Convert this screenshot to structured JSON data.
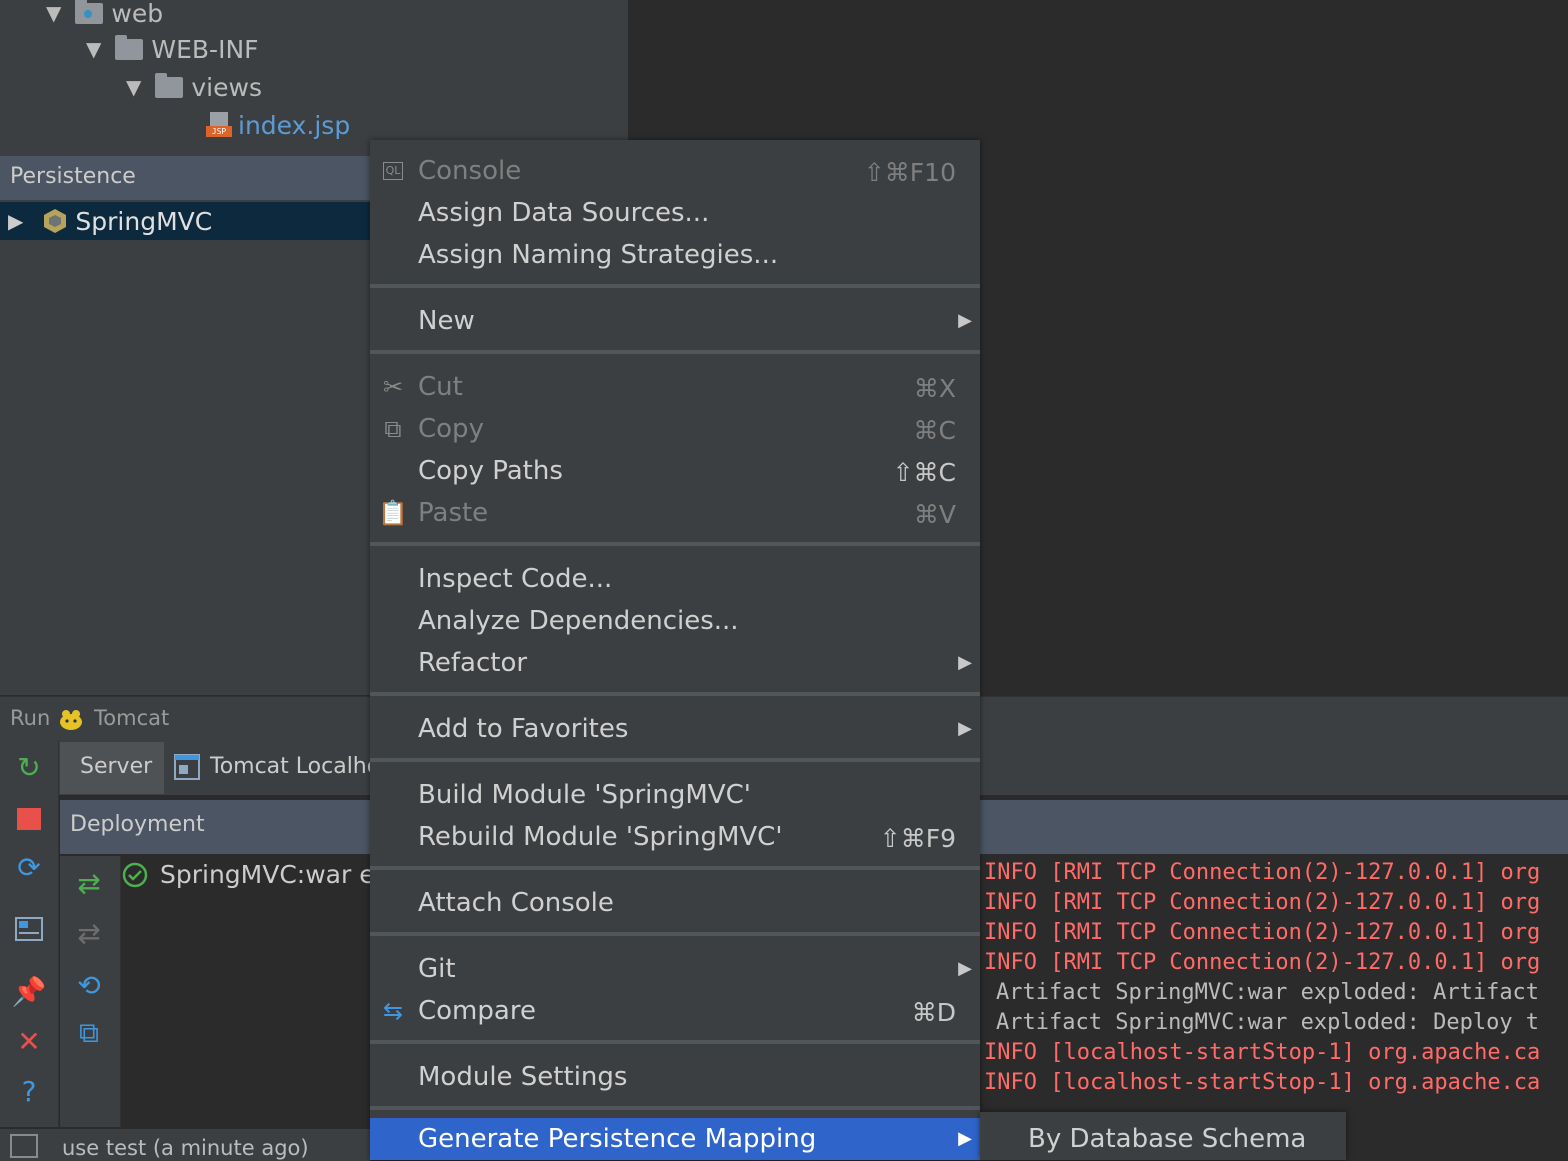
{
  "project_tree": {
    "items": [
      {
        "label": "web"
      },
      {
        "label": "WEB-INF"
      },
      {
        "label": "views"
      },
      {
        "label": "index.jsp"
      }
    ],
    "jsp_tag": "JSP",
    "selected_color": "#5c9bd6"
  },
  "persistence": {
    "title": "Persistence",
    "item": "SpringMVC"
  },
  "run_bar": {
    "run_label": "Run",
    "config_name": "Tomcat"
  },
  "tabs": {
    "server": "Server",
    "localhost": "Tomcat Localho"
  },
  "deployment": {
    "header": "Deployment",
    "item": "SpringMVC:war e"
  },
  "log_lines": [
    "INFO [RMI TCP Connection(2)-127.0.0.1] org",
    "INFO [RMI TCP Connection(2)-127.0.0.1] org",
    "INFO [RMI TCP Connection(2)-127.0.0.1] org",
    "INFO [RMI TCP Connection(2)-127.0.0.1] org",
    "Artifact SpringMVC:war exploded: Artifact",
    "Artifact SpringMVC:war exploded: Deploy t",
    "INFO [localhost-startStop-1] org.apache.ca",
    "INFO [localhost-startStop-1] org.apache.ca"
  ],
  "status_bar": {
    "text": "use test (a minute ago)"
  },
  "context_menu": {
    "console": {
      "label": "Console",
      "shortcut": "⇧⌘F10",
      "icon": "ql-console-icon"
    },
    "assign_data_sources": {
      "label": "Assign Data Sources..."
    },
    "assign_naming": {
      "label": "Assign Naming Strategies..."
    },
    "new": {
      "label": "New"
    },
    "cut": {
      "label": "Cut",
      "shortcut": "⌘X"
    },
    "copy": {
      "label": "Copy",
      "shortcut": "⌘C"
    },
    "copy_paths": {
      "label": "Copy Paths",
      "shortcut": "⇧⌘C"
    },
    "paste": {
      "label": "Paste",
      "shortcut": "⌘V"
    },
    "inspect_code": {
      "label": "Inspect Code..."
    },
    "analyze_deps": {
      "label": "Analyze Dependencies..."
    },
    "refactor": {
      "label": "Refactor"
    },
    "add_favorites": {
      "label": "Add to Favorites"
    },
    "build_module": {
      "label": "Build Module 'SpringMVC'"
    },
    "rebuild_module": {
      "label": "Rebuild Module 'SpringMVC'",
      "shortcut": "⇧⌘F9"
    },
    "attach_console": {
      "label": "Attach Console"
    },
    "git": {
      "label": "Git"
    },
    "compare": {
      "label": "Compare",
      "shortcut": "⌘D"
    },
    "module_settings": {
      "label": "Module Settings"
    },
    "generate_mapping": {
      "label": "Generate Persistence Mapping"
    }
  },
  "submenu": {
    "item": "By Database Schema"
  },
  "colors": {
    "menu_bg": "#3c3f41",
    "selection": "#2f65ca",
    "log_error": "#ff6b68",
    "editor_bg": "#2b2b2b"
  }
}
